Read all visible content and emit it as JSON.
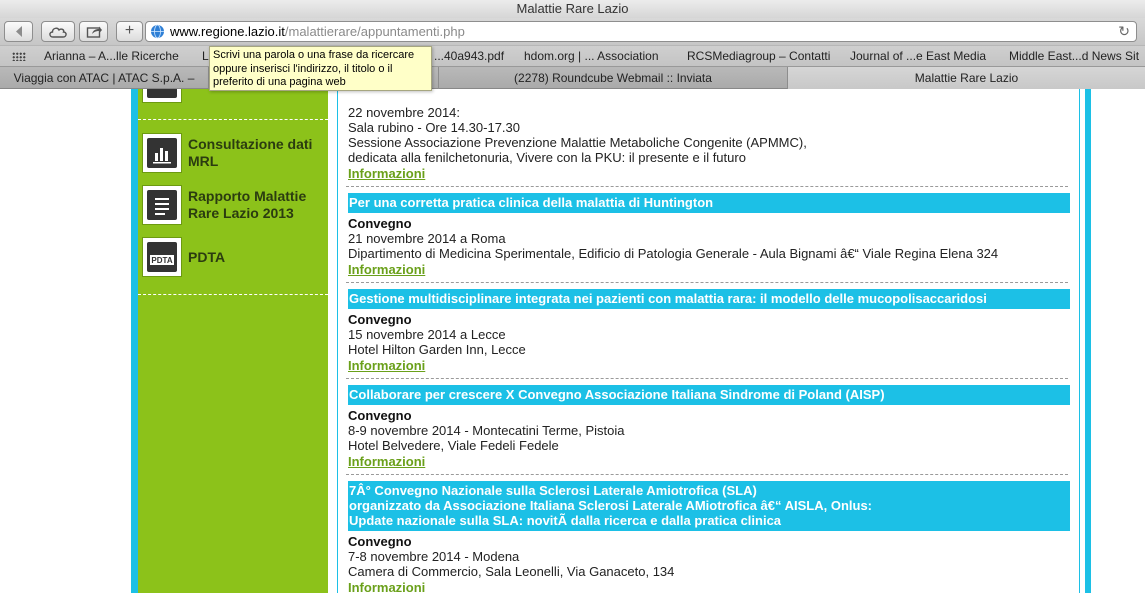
{
  "window": {
    "title": "Malattie Rare Lazio"
  },
  "toolbar": {
    "address_host": "www.regione.lazio.it",
    "address_path": "/malattierare/appuntamenti.php",
    "add_label": "+"
  },
  "bookmarks": [
    "Arianna – A...lle Ricerche",
    "L",
    "...40a943.pdf",
    "hdom.org | ... Association",
    "RCSMediagroup – Contatti",
    "Journal of ...e East Media",
    "Middle East...d News Sit"
  ],
  "tabs": [
    {
      "label": "Viaggia con ATAC | ATAC S.p.A. –"
    },
    {
      "label": ""
    },
    {
      "label": "(2278) Roundcube Webmail :: Inviata"
    },
    {
      "label": "Malattie Rare Lazio"
    }
  ],
  "tooltip": {
    "text": "Scrivi una parola o una frase da ricercare oppure inserisci l'indirizzo, il titolo o il preferito di una pagina web"
  },
  "sidebar": {
    "items": [
      {
        "label": "Consultazione dati MRL",
        "icon": "bar-chart-icon"
      },
      {
        "label": "Rapporto Malattie Rare Lazio 2013",
        "icon": "document-icon"
      },
      {
        "label": "PDTA",
        "icon": "pdta-icon"
      }
    ]
  },
  "events": {
    "first": {
      "lines": [
        "22 novembre 2014:",
        "Sala rubino - Ore 14.30-17.30",
        "Sessione Associazione Prevenzione Malattie Metaboliche Congenite (APMMC),",
        "dedicata alla fenilchetonuria, Vivere con la PKU: il presente e il futuro"
      ],
      "link": "Informazioni"
    },
    "items": [
      {
        "title": "Per una corretta pratica clinica della malattia di Huntington",
        "type": "Convegno",
        "date": "21 novembre 2014 a Roma",
        "place": "Dipartimento di Medicina Sperimentale, Edificio di Patologia Generale - Aula Bignami â€“ Viale Regina Elena 324",
        "link": "Informazioni"
      },
      {
        "title": "Gestione multidisciplinare integrata nei pazienti con malattia rara: il modello delle mucopolisaccaridosi",
        "type": "Convegno",
        "date": "15 novembre 2014 a Lecce",
        "place": "Hotel Hilton Garden Inn, Lecce",
        "link": "Informazioni"
      },
      {
        "title": "Collaborare per crescere X Convegno Associazione Italiana Sindrome di Poland (AISP)",
        "type": "Convegno",
        "date": "8-9 novembre 2014 - Montecatini Terme, Pistoia",
        "place": "Hotel Belvedere, Viale Fedeli Fedele",
        "link": "Informazioni"
      },
      {
        "title_lines": [
          "7Â° Convegno Nazionale sulla Sclerosi Laterale Amiotrofica (SLA)",
          "organizzato da Associazione Italiana Sclerosi Laterale AMiotrofica â€“ AISLA, Onlus:",
          "Update nazionale sulla SLA: novitÃ  dalla ricerca e dalla pratica clinica"
        ],
        "type": "Convegno",
        "date": "7-8 novembre 2014 - Modena",
        "place": "Camera di Commercio, Sala Leonelli, Via Ganaceto, 134",
        "link": "Informazioni"
      }
    ]
  }
}
